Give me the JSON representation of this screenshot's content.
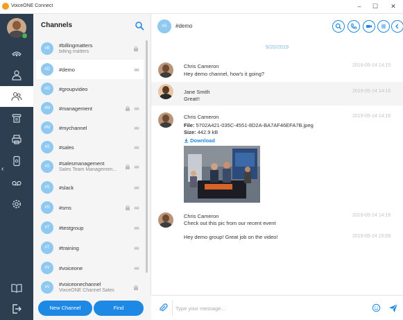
{
  "window": {
    "app_title": "VoiceONE Connect",
    "controls": {
      "minimize": "–",
      "maximize": "☐",
      "close": "✕"
    }
  },
  "rail": {
    "items": [
      {
        "icon": "speed-dial-icon"
      },
      {
        "icon": "contacts-icon"
      },
      {
        "icon": "channels-icon",
        "active": true
      },
      {
        "icon": "phone-icon"
      },
      {
        "icon": "fax-icon"
      },
      {
        "icon": "mobile-icon"
      },
      {
        "icon": "voicemail-icon"
      },
      {
        "icon": "settings-icon"
      }
    ],
    "bottom": [
      {
        "icon": "book-icon"
      },
      {
        "icon": "logout-icon"
      }
    ]
  },
  "channels_panel": {
    "title": "Channels",
    "channels": [
      {
        "badge": "#B",
        "name": "#billingmatters",
        "description": "billing matters",
        "lock": true,
        "crown": false
      },
      {
        "badge": "#D",
        "name": "#demo",
        "description": "",
        "lock": false,
        "crown": true,
        "selected": true
      },
      {
        "badge": "#G",
        "name": "#groupvideo",
        "description": "",
        "lock": false,
        "crown": false
      },
      {
        "badge": "#M",
        "name": "#management",
        "description": "",
        "lock": true,
        "crown": true
      },
      {
        "badge": "#M",
        "name": "#mychannel",
        "description": "",
        "lock": false,
        "crown": true
      },
      {
        "badge": "#S",
        "name": "#sales",
        "description": "",
        "lock": false,
        "crown": true
      },
      {
        "badge": "#S",
        "name": "#salesmanagement",
        "description": "Sales Team Managemen...",
        "lock": true,
        "crown": true
      },
      {
        "badge": "#S",
        "name": "#slack",
        "description": "",
        "lock": false,
        "crown": true
      },
      {
        "badge": "#S",
        "name": "#sms",
        "description": "",
        "lock": true,
        "crown": true
      },
      {
        "badge": "#T",
        "name": "#testgroup",
        "description": "",
        "lock": false,
        "crown": true
      },
      {
        "badge": "#T",
        "name": "#training",
        "description": "",
        "lock": false,
        "crown": true
      },
      {
        "badge": "#V",
        "name": "#voiceone",
        "description": "",
        "lock": false,
        "crown": true
      },
      {
        "badge": "#V",
        "name": "#voiceonechannel",
        "description": "VoiceONE Channel Sales",
        "lock": true,
        "crown": false
      }
    ],
    "new_channel_label": "New Channel",
    "find_label": "Find"
  },
  "conversation": {
    "badge": "#S",
    "title": "#demo",
    "date_divider": "9/20/2019",
    "messages": [
      {
        "sender": "Chris Cameron",
        "text": "Hey demo channel, how's it going?",
        "time": "2019-05-14 14:15",
        "avatar": "man"
      },
      {
        "sender": "Jane Smith",
        "text": "Great!!",
        "time": "2019-05-14 14:16",
        "avatar": "woman"
      },
      {
        "sender": "Chris Cameron",
        "time": "2019-05-14 14:16",
        "avatar": "man",
        "file_label": "File",
        "file_name": "5702A421-035C-4551-8D2A-BA7AF46EFA7B.jpeg",
        "size_label": "Size",
        "size_value": "442.9 kB",
        "download_label": "Download"
      },
      {
        "sender": "Chris Cameron",
        "text": "Check out this pic from our recent event",
        "time": "2019-05-14 14:16",
        "avatar": "man"
      },
      {
        "text": "Hey demo group! Great job on the video!",
        "time": "2019-05-14 15:09"
      }
    ]
  },
  "composer": {
    "placeholder": "Type your message..."
  },
  "colors": {
    "accent": "#1e88e5",
    "rail_bg": "#2d3e50",
    "badge": "#8fc8f0",
    "date": "#7fbbe8",
    "presence": "#4caf50"
  }
}
